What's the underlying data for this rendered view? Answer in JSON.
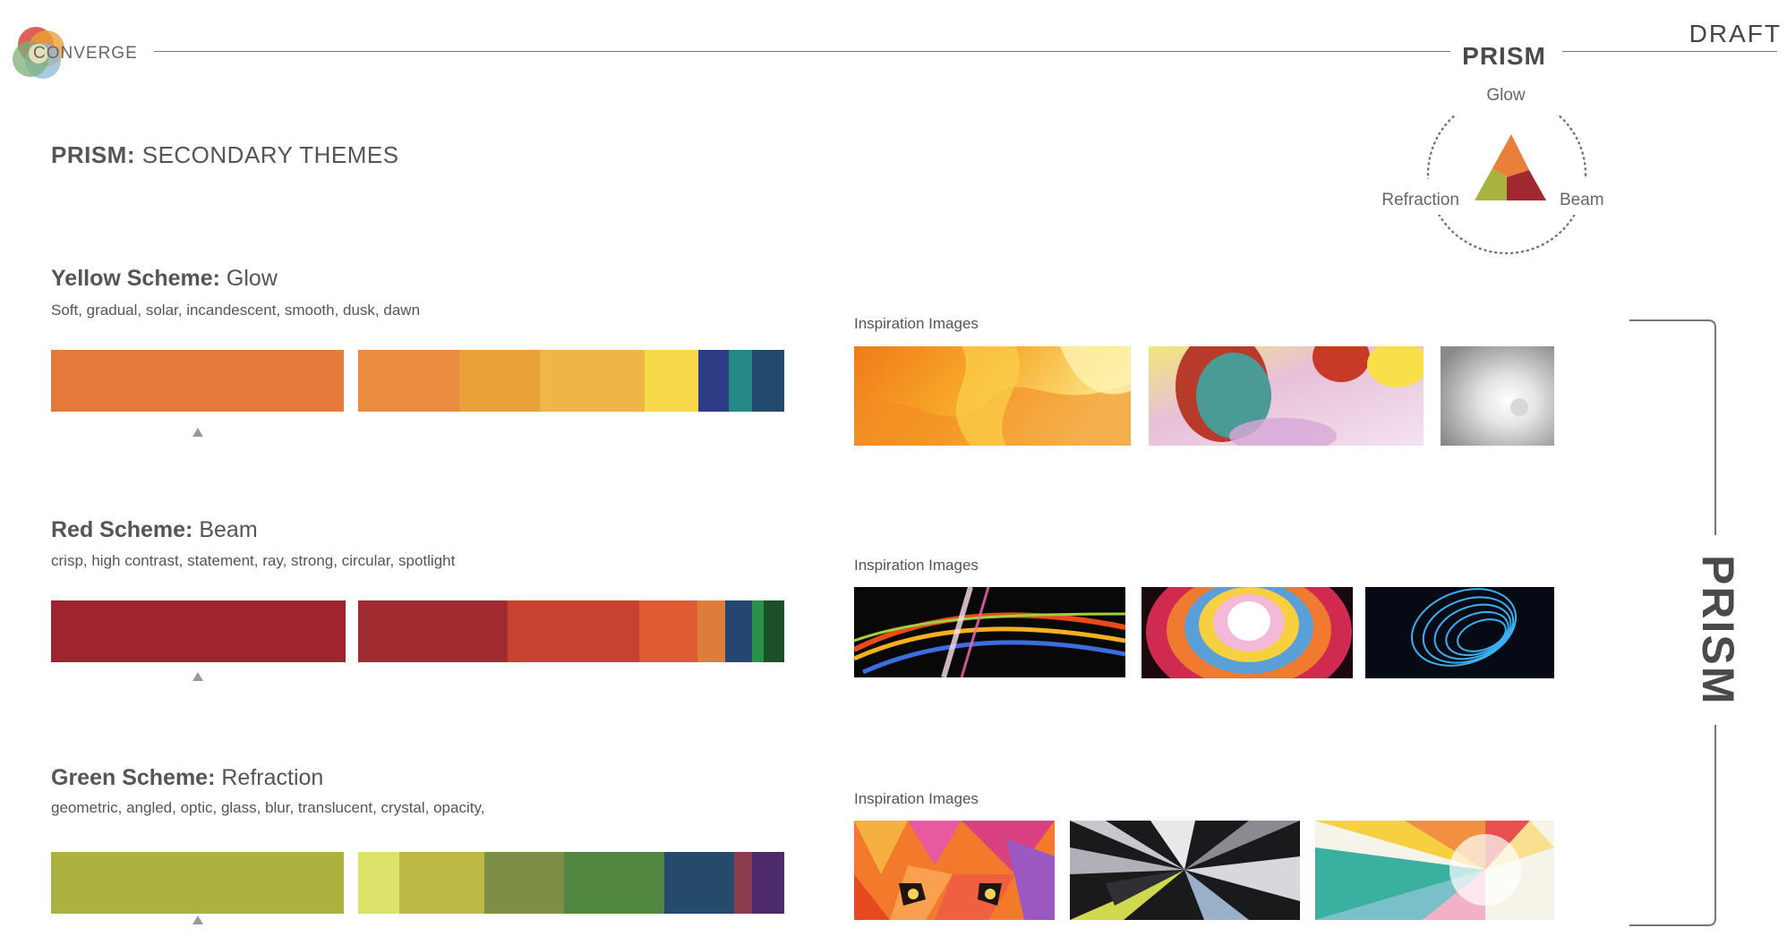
{
  "header": {
    "brand": "CONVERGE",
    "prism_title": "PRISM",
    "draft": "DRAFT"
  },
  "page_title": {
    "bold": "PRISM:",
    "rest": " SECONDARY THEMES"
  },
  "triad": {
    "top": "Glow",
    "left": "Refraction",
    "right": "Beam",
    "colors": {
      "top": "#e8803a",
      "left": "#a8b23e",
      "right": "#a02830"
    }
  },
  "schemes": [
    {
      "title_bold": "Yellow Scheme:",
      "title_rest": " Glow",
      "desc": "Soft, gradual, solar, incandescent, smooth, dusk, dawn",
      "main_color": "#e67a3a",
      "palette": [
        {
          "color": "#e98c3f",
          "weight": 89
        },
        {
          "color": "#e9a23a",
          "weight": 71
        },
        {
          "color": "#efb546",
          "weight": 92
        },
        {
          "color": "#f5d948",
          "weight": 47
        },
        {
          "color": "#2e3c86",
          "weight": 27
        },
        {
          "color": "#268884",
          "weight": 21
        },
        {
          "color": "#23496e",
          "weight": 28
        }
      ],
      "insp_label": "Inspiration Images"
    },
    {
      "title_bold": "Red Scheme:",
      "title_rest": " Beam",
      "desc": "crisp, high contrast, statement, ray, strong, circular, spotlight",
      "main_color": "#9e252f",
      "palette": [
        {
          "color": "#a02b30",
          "weight": 131
        },
        {
          "color": "#c84232",
          "weight": 116
        },
        {
          "color": "#e05a34",
          "weight": 51
        },
        {
          "color": "#dd7d3c",
          "weight": 24
        },
        {
          "color": "#254670",
          "weight": 24
        },
        {
          "color": "#2a9148",
          "weight": 10
        },
        {
          "color": "#1b5028",
          "weight": 18
        }
      ],
      "insp_label": "Inspiration Images"
    },
    {
      "title_bold": "Green Scheme:",
      "title_rest": " Refraction",
      "desc": "geometric, angled, optic, glass, blur, translucent, crystal, opacity,",
      "main_color": "#adb140",
      "palette": [
        {
          "color": "#dde26a",
          "weight": 36
        },
        {
          "color": "#bdb944",
          "weight": 75
        },
        {
          "color": "#7d8f46",
          "weight": 70
        },
        {
          "color": "#528741",
          "weight": 88
        },
        {
          "color": "#264a6c",
          "weight": 61
        },
        {
          "color": "#8a3b4d",
          "weight": 16
        },
        {
          "color": "#4c2a6c",
          "weight": 28
        }
      ],
      "insp_label": "Inspiration Images"
    }
  ],
  "side_label": "PRISM"
}
